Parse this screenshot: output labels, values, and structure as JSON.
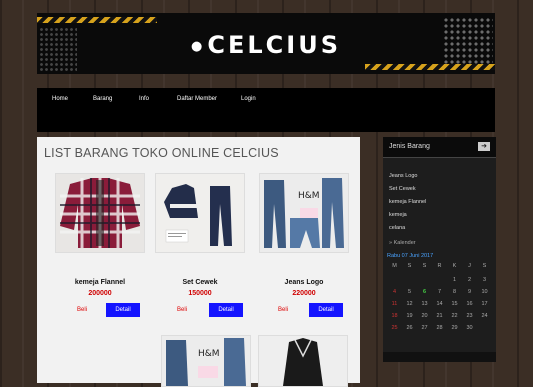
{
  "site": {
    "logo": "CELCIUS"
  },
  "nav": {
    "items": [
      "Home",
      "Barang",
      "Info",
      "Daftar Member",
      "Login"
    ]
  },
  "main": {
    "title": "LIST BARANG TOKO ONLINE CELCIUS",
    "products": [
      {
        "name": "kemeja Flannel",
        "price": "200000",
        "buy": "Beli",
        "detail": "Detail"
      },
      {
        "name": "Set Cewek",
        "price": "150000",
        "buy": "Beli",
        "detail": "Detail"
      },
      {
        "name": "Jeans Logo",
        "price": "220000",
        "buy": "Beli",
        "detail": "Detail"
      }
    ]
  },
  "sidebar": {
    "title": "Jenis Barang",
    "categories": [
      "Jeans Logo",
      "Set Cewek",
      "kemeja Flannel",
      "kemeja",
      "celana"
    ],
    "calendar_header": "Kalender",
    "calendar_date": "Rabu 07 Juni 2017",
    "weekdays": [
      "M",
      "S",
      "S",
      "R",
      "K",
      "J",
      "S"
    ],
    "days": [
      "",
      "",
      "",
      "",
      "1",
      "2",
      "3",
      "4",
      "5",
      "6",
      "7",
      "8",
      "9",
      "10",
      "11",
      "12",
      "13",
      "14",
      "15",
      "16",
      "17",
      "18",
      "19",
      "20",
      "21",
      "22",
      "23",
      "24",
      "25",
      "26",
      "27",
      "28",
      "29",
      "30",
      ""
    ],
    "today": "6"
  },
  "colors": {
    "accent": "#1414ff",
    "price": "#d00000",
    "today": "#44cc44",
    "sunday": "#cc3333"
  }
}
